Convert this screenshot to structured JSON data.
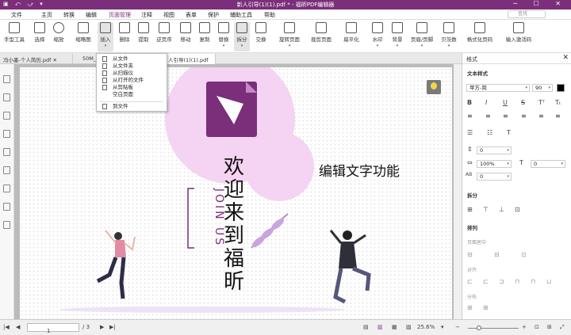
{
  "window": {
    "title": "新人引导(1)(1).pdf * - 福昕PDF编辑器"
  },
  "menu": {
    "file": "文件",
    "home": "主页",
    "convert": "转换",
    "edit": "编辑",
    "page_manage": "页面管理",
    "comment": "注释",
    "view": "视图",
    "form": "表单",
    "protect": "保护",
    "tools": "辅助工具",
    "help": "帮助"
  },
  "search": {
    "placeholder": "查找"
  },
  "ribbon": {
    "hand": "手型工具",
    "select": "选择",
    "zoom": "缩放",
    "thumbnail": "缩略图",
    "insert": "插入",
    "delete": "删除",
    "extract": "提取",
    "reverse": "逆页序",
    "move": "移动",
    "copy": "复制",
    "replace": "替换",
    "split": "拆分",
    "swap": "交换",
    "rotate": "旋转页面",
    "crop": "裁剪页面",
    "flatten": "扁平化",
    "watermark": "水印",
    "background": "背景",
    "header_footer": "页眉/页脚",
    "bates": "贝茨数",
    "format_page": "格式化页码",
    "activate": "输入激活码"
  },
  "tabs": [
    "冯小墨-个人简历.pdf",
    "50M_c",
    "人引导(1)(1).pdf *"
  ],
  "insert_menu": [
    "从文件",
    "从文件夹",
    "从扫描仪",
    "从打开的文件",
    "从剪贴板",
    "空白页面",
    "到文件"
  ],
  "page": {
    "welcome": "欢迎来到福昕",
    "join": "JOIN US",
    "feature": "编辑文字功能"
  },
  "panel": {
    "title": "格式",
    "text_style": "文本样式",
    "font": "苹方-简",
    "size": "90",
    "indent1": "0",
    "scale": "100%",
    "indent2": "0",
    "char_spacing": "0",
    "split": "拆分",
    "arrange": "排列",
    "center": "页面居中",
    "align": "对齐",
    "distribute": "分布"
  },
  "status": {
    "page_current": "1",
    "page_total": "/ 3",
    "zoom": "25.6%"
  },
  "colors": {
    "brand": "#7b2e7a",
    "pink": "#f5d3f2"
  }
}
